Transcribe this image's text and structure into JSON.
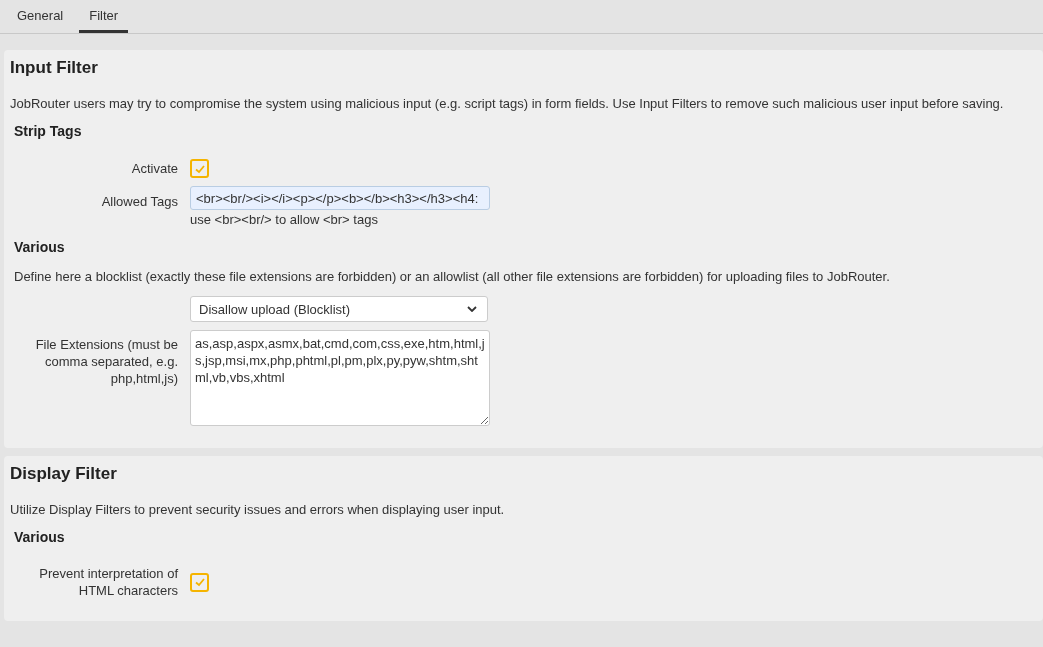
{
  "tabs": [
    {
      "label": "General",
      "selected": false
    },
    {
      "label": "Filter",
      "selected": true
    }
  ],
  "sections": [
    {
      "title": "Input Filter",
      "description": "JobRouter users may try to compromise the system using malicious input (e.g. script tags) in form fields. Use Input Filters to remove such malicious user input before saving.",
      "groups": [
        {
          "heading": "Strip Tags",
          "fields": [
            {
              "kind": "checkbox",
              "label": "Activate",
              "checked": true
            },
            {
              "kind": "text",
              "label": "Allowed Tags",
              "value": "<br><br/><i></i><p></p><b></b><h3></h3><h4:",
              "hint": "use <br><br/> to allow <br> tags"
            }
          ]
        },
        {
          "heading": "Various",
          "description": "Define here a blocklist (exactly these file extensions are forbidden) or an allowlist (all other file extensions are forbidden) for uploading files to JobRouter.",
          "fields": [
            {
              "kind": "select",
              "value": "Disallow upload (Blocklist)"
            },
            {
              "kind": "textarea",
              "label": "File Extensions (must be comma separated, e.g. php,html,js)",
              "value": "as,asp,aspx,asmx,bat,cmd,com,css,exe,htm,html,js,jsp,msi,mx,php,phtml,pl,pm,plx,py,pyw,shtm,shtml,vb,vbs,xhtml"
            }
          ]
        }
      ]
    },
    {
      "title": "Display Filter",
      "description": "Utilize Display Filters to prevent security issues and errors when displaying user input.",
      "groups": [
        {
          "heading": "Various",
          "fields": [
            {
              "kind": "checkbox",
              "label": "Prevent interpretation of HTML characters",
              "checked": true
            }
          ]
        }
      ]
    }
  ]
}
